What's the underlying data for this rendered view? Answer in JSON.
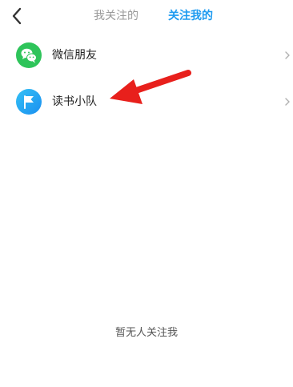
{
  "header": {
    "back_icon": "chevron-left-icon",
    "tabs": [
      {
        "label": "我关注的",
        "active": false
      },
      {
        "label": "关注我的",
        "active": true
      }
    ],
    "active_color": "#1e9bf0",
    "inactive_color": "#999999"
  },
  "list": {
    "items": [
      {
        "label": "微信朋友",
        "icon": "wechat-icon",
        "icon_color": "#2ec45a"
      },
      {
        "label": "读书小队",
        "icon": "flag-icon",
        "icon_color": "#1a9af2"
      }
    ]
  },
  "annotation": {
    "icon": "red-arrow-icon",
    "color": "#e8201c"
  },
  "empty_state": {
    "text": "暂无人关注我"
  }
}
